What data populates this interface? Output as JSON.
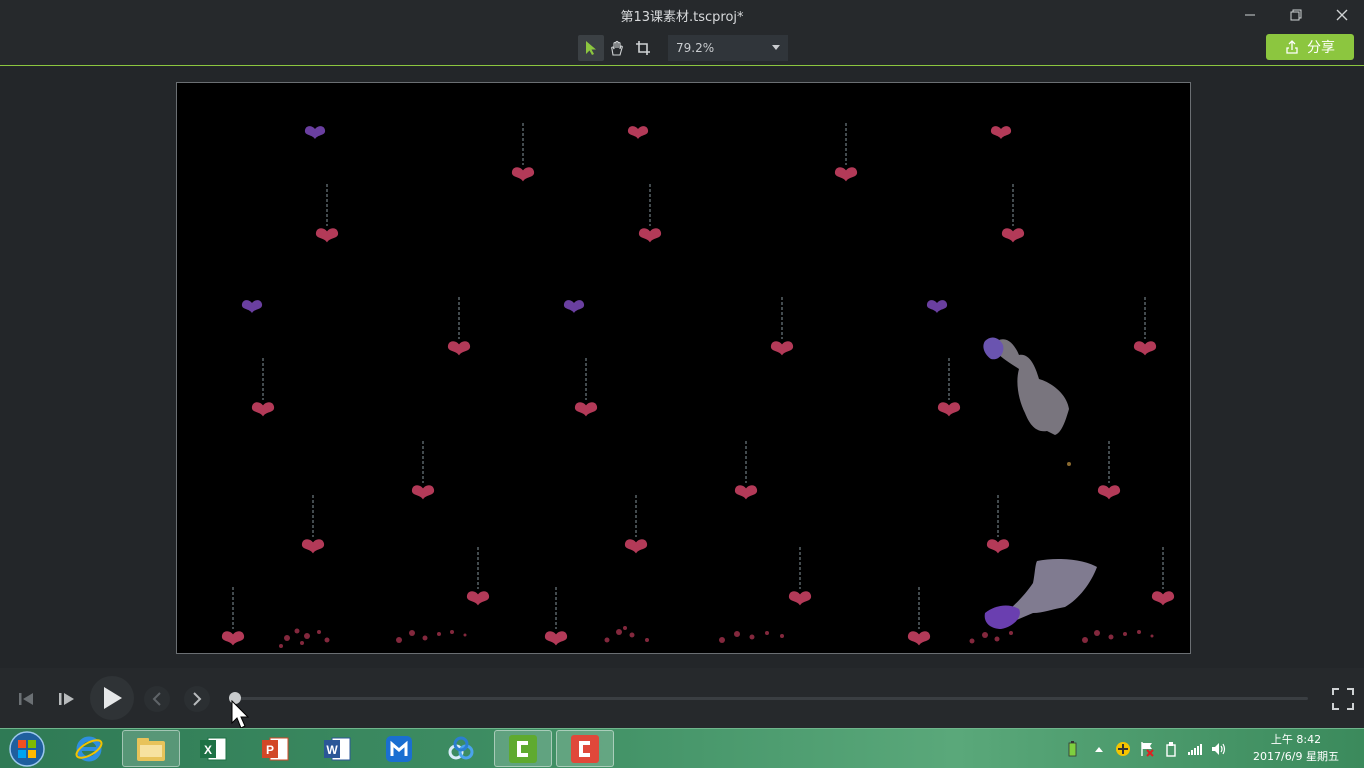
{
  "window": {
    "title": "第13课素材.tscproj*",
    "minimize_icon": "minimize-icon",
    "restore_icon": "restore-icon",
    "close_icon": "close-icon"
  },
  "toolbar": {
    "tools": [
      "select-arrow-icon",
      "pan-hand-icon",
      "crop-icon"
    ],
    "zoom_value": "79.2%",
    "share_label": "分享"
  },
  "colors": {
    "accent": "#8cc63f",
    "background": "#232629",
    "canvas": "#000000",
    "heart": "#c0405e",
    "purple_heart": "#6a3fa0"
  },
  "playback": {
    "progress_percent": 0,
    "buttons": [
      "step-back-icon",
      "step-forward-icon",
      "play-icon",
      "previous-marker-icon",
      "next-marker-icon",
      "fullscreen-icon"
    ]
  },
  "taskbar": {
    "apps": [
      "start-orb-icon",
      "internet-explorer-icon",
      "file-explorer-icon",
      "excel-icon",
      "powerpoint-icon",
      "word-icon",
      "maxthon-icon",
      "baidu-cloud-icon",
      "camtasia-green-icon",
      "camtasia-red-icon"
    ],
    "tray_icons": [
      "battery-icon",
      "show-hidden-icon",
      "update-icon",
      "flag-icon",
      "usb-icon",
      "network-icon",
      "volume-icon"
    ],
    "time": "上午 8:42",
    "date": "2017/6/9 星期五"
  }
}
